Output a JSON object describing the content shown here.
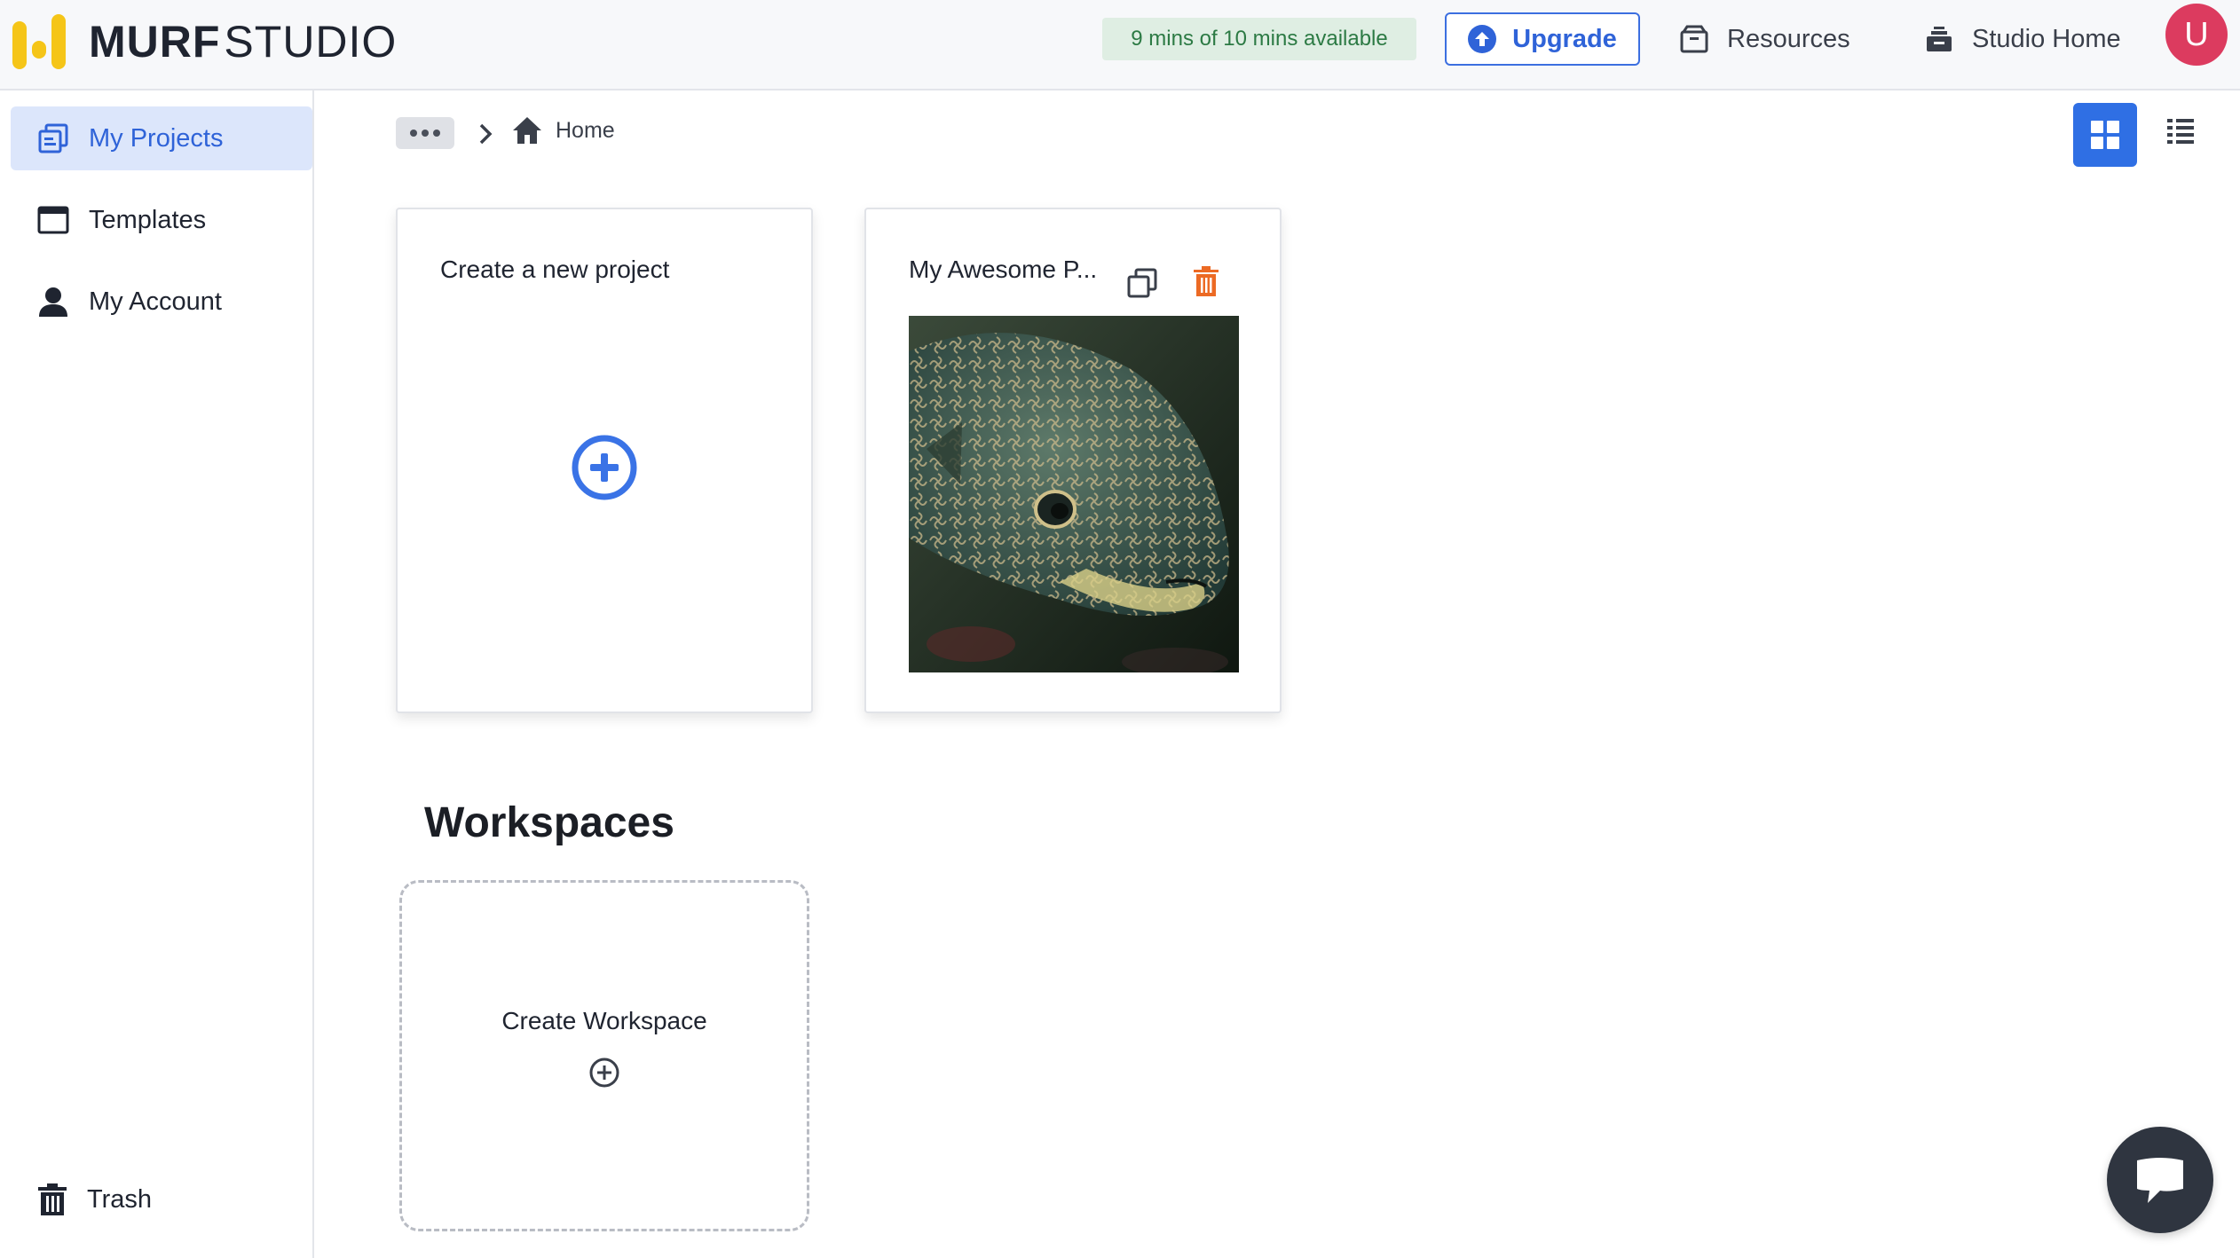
{
  "brand": {
    "name_bold": "MURF",
    "name_light": "STUDIO",
    "color": "#f5c518"
  },
  "header": {
    "usage_text": "9 mins of 10 mins available",
    "upgrade_label": "Upgrade",
    "resources_label": "Resources",
    "studio_home_label": "Studio Home",
    "avatar_initial": "U",
    "accent_color": "#2f63d8"
  },
  "sidebar": {
    "items": [
      {
        "label": "My Projects",
        "icon": "projects-icon",
        "active": true
      },
      {
        "label": "Templates",
        "icon": "templates-icon",
        "active": false
      },
      {
        "label": "My Account",
        "icon": "account-icon",
        "active": false
      }
    ],
    "trash_label": "Trash"
  },
  "breadcrumb": {
    "home_label": "Home"
  },
  "view": {
    "selected": "grid"
  },
  "projects": {
    "new_project_label": "Create a new project",
    "items": [
      {
        "title": "My Awesome P...",
        "thumbnail": "pufferfish-photo"
      }
    ]
  },
  "workspaces": {
    "title": "Workspaces",
    "create_label": "Create Workspace"
  }
}
